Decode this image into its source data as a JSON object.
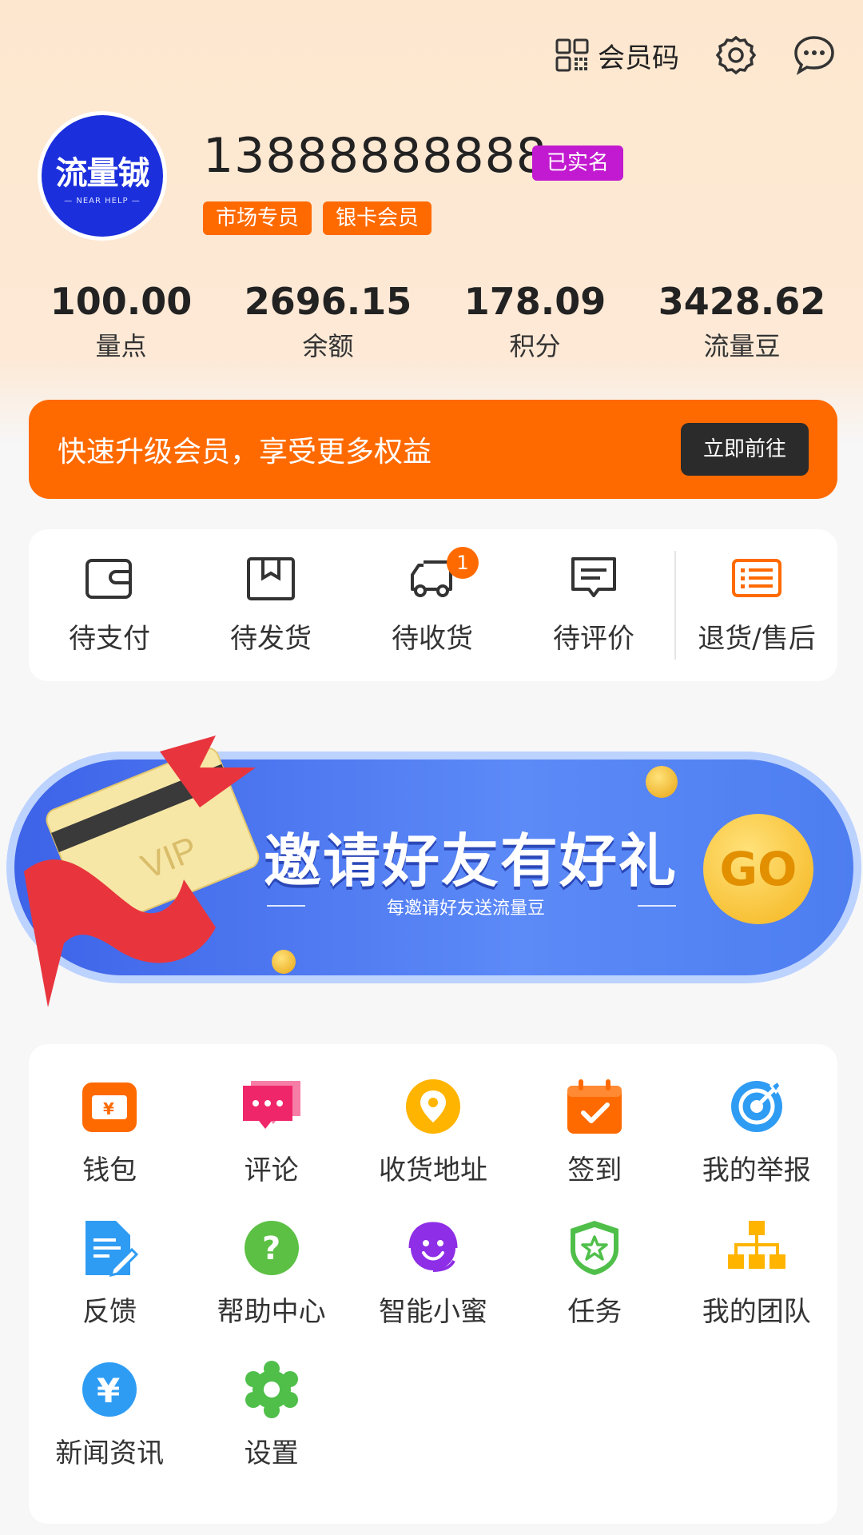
{
  "header": {
    "member_code_label": "会员码",
    "icons": [
      "qr-code-icon",
      "gear-icon",
      "message-icon"
    ]
  },
  "profile": {
    "avatar_text": "流量铖",
    "avatar_subtext": "— NEAR HELP —",
    "phone": "13888888888",
    "verified_label": "已实名",
    "tags": [
      "市场专员",
      "银卡会员"
    ]
  },
  "stats": [
    {
      "value": "100.00",
      "label": "量点"
    },
    {
      "value": "2696.15",
      "label": "余额"
    },
    {
      "value": "178.09",
      "label": "积分"
    },
    {
      "value": "3428.62",
      "label": "流量豆"
    }
  ],
  "upgrade_banner": {
    "message": "快速升级会员，享受更多权益",
    "button_label": "立即前往"
  },
  "orders": [
    {
      "label": "待支付",
      "icon": "wallet-icon"
    },
    {
      "label": "待发货",
      "icon": "package-icon"
    },
    {
      "label": "待收货",
      "icon": "truck-icon",
      "badge": "1"
    },
    {
      "label": "待评价",
      "icon": "comment-icon"
    },
    {
      "label": "退货/售后",
      "icon": "list-icon"
    }
  ],
  "invite": {
    "title": "邀请好友有好礼",
    "subtitle": "每邀请好友送流量豆",
    "card_text": "VIP",
    "go_label": "GO"
  },
  "menu": [
    {
      "label": "钱包",
      "icon": "wallet-icon",
      "color": "#ff6a00"
    },
    {
      "label": "评论",
      "icon": "comment-icon",
      "color": "#f0266b"
    },
    {
      "label": "收货地址",
      "icon": "location-icon",
      "color": "#ffb400"
    },
    {
      "label": "签到",
      "icon": "calendar-check-icon",
      "color": "#ff6a00"
    },
    {
      "label": "我的举报",
      "icon": "target-icon",
      "color": "#2f9cf4"
    },
    {
      "label": "反馈",
      "icon": "document-edit-icon",
      "color": "#2f9cf4"
    },
    {
      "label": "帮助中心",
      "icon": "help-icon",
      "color": "#5cc044"
    },
    {
      "label": "智能小蜜",
      "icon": "headset-smile-icon",
      "color": "#8e2ee6"
    },
    {
      "label": "任务",
      "icon": "shield-star-icon",
      "color": "#4fbf4a"
    },
    {
      "label": "我的团队",
      "icon": "org-chart-icon",
      "color": "#ffb400"
    },
    {
      "label": "新闻资讯",
      "icon": "yen-icon",
      "color": "#2f9cf4"
    },
    {
      "label": "设置",
      "icon": "gear-icon",
      "color": "#4fbf4a"
    }
  ]
}
